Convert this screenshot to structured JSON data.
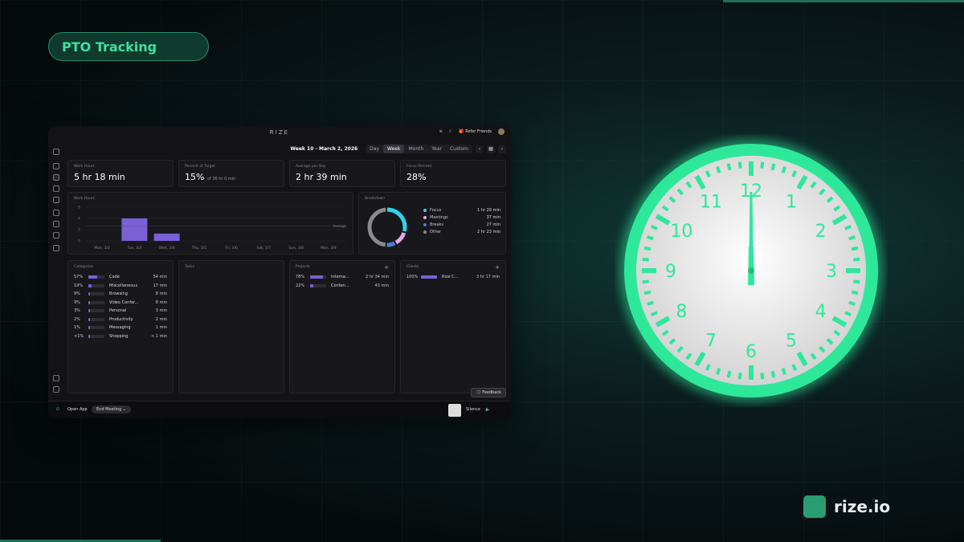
{
  "badge": {
    "label": "PTO Tracking"
  },
  "app": {
    "title": "RIZE",
    "refer": "Refer Friends",
    "week_label": "Week 10 - March 2, 2026",
    "ranges": [
      "Day",
      "Week",
      "Month",
      "Year",
      "Custom"
    ],
    "active_range": "Week"
  },
  "stats": [
    {
      "label": "Work Hours",
      "value": "5 hr 18 min",
      "sub": ""
    },
    {
      "label": "Percent of Target",
      "value": "15%",
      "sub": "of 36 hr 0 min"
    },
    {
      "label": "Average per Day",
      "value": "2 hr 39 min",
      "sub": ""
    },
    {
      "label": "Focus Percent",
      "value": "28%",
      "sub": ""
    }
  ],
  "chart_data": {
    "type": "bar",
    "title": "Work Hours",
    "categories": [
      "Mon, 3/2",
      "Tue, 3/3",
      "Wed, 3/4",
      "Thu, 3/5",
      "Fri, 3/6",
      "Sat, 3/7",
      "Sun, 3/8",
      "Mon, 3/9"
    ],
    "values": [
      0,
      4,
      1.3,
      0,
      0,
      0,
      0,
      0
    ],
    "yticks": [
      0,
      2,
      4,
      6
    ],
    "ylim": [
      0,
      6
    ],
    "average_label": "Average",
    "average_value": 2.65,
    "color": "#7b5fd6"
  },
  "breakdown": {
    "title": "Breakdown",
    "items": [
      {
        "label": "Focus",
        "value": "1 hr 29 min",
        "color": "#2fd3e8",
        "fraction": 0.28
      },
      {
        "label": "Meetings",
        "value": "37 min",
        "color": "#e7a6e8",
        "fraction": 0.12
      },
      {
        "label": "Breaks",
        "value": "27 min",
        "color": "#4f7fd6",
        "fraction": 0.08
      },
      {
        "label": "Other",
        "value": "2 hr 23 min",
        "color": "#8a8a90",
        "fraction": 0.45
      }
    ]
  },
  "categories": {
    "title": "Categories",
    "rows": [
      {
        "pct": "57%",
        "fill": 0.57,
        "name": "Code",
        "value": "54 min"
      },
      {
        "pct": "19%",
        "fill": 0.19,
        "name": "Miscellaneous",
        "value": "17 min"
      },
      {
        "pct": "9%",
        "fill": 0.09,
        "name": "Browsing",
        "value": "8 min"
      },
      {
        "pct": "9%",
        "fill": 0.09,
        "name": "Video Confer...",
        "value": "8 min"
      },
      {
        "pct": "3%",
        "fill": 0.03,
        "name": "Personal",
        "value": "3 min"
      },
      {
        "pct": "2%",
        "fill": 0.02,
        "name": "Productivity",
        "value": "2 min"
      },
      {
        "pct": "1%",
        "fill": 0.01,
        "name": "Messaging",
        "value": "1 min"
      },
      {
        "pct": "<1%",
        "fill": 0.005,
        "name": "Shopping",
        "value": "< 1 min"
      }
    ]
  },
  "tasks": {
    "title": "Tasks"
  },
  "projects": {
    "title": "Projects",
    "rows": [
      {
        "pct": "78%",
        "fill": 0.78,
        "name": "Interna...",
        "value": "2 hr 34 min"
      },
      {
        "pct": "22%",
        "fill": 0.22,
        "name": "Conten...",
        "value": "43 min"
      }
    ]
  },
  "clients": {
    "title": "Clients",
    "rows": [
      {
        "pct": "100%",
        "fill": 1.0,
        "name": "Rize C...",
        "value": "3 hr 17 min"
      }
    ]
  },
  "footer": {
    "feedback": "Feedback",
    "open_app": "Open App",
    "end_meeting": "End Meeting",
    "silence": "Silence"
  },
  "clock": {
    "numbers": [
      "12",
      "1",
      "2",
      "3",
      "4",
      "5",
      "6",
      "7",
      "8",
      "9",
      "10",
      "11"
    ],
    "rim_color": "#2ee89a"
  },
  "brand": {
    "name": "rize.io",
    "color": "#2a9c72"
  }
}
